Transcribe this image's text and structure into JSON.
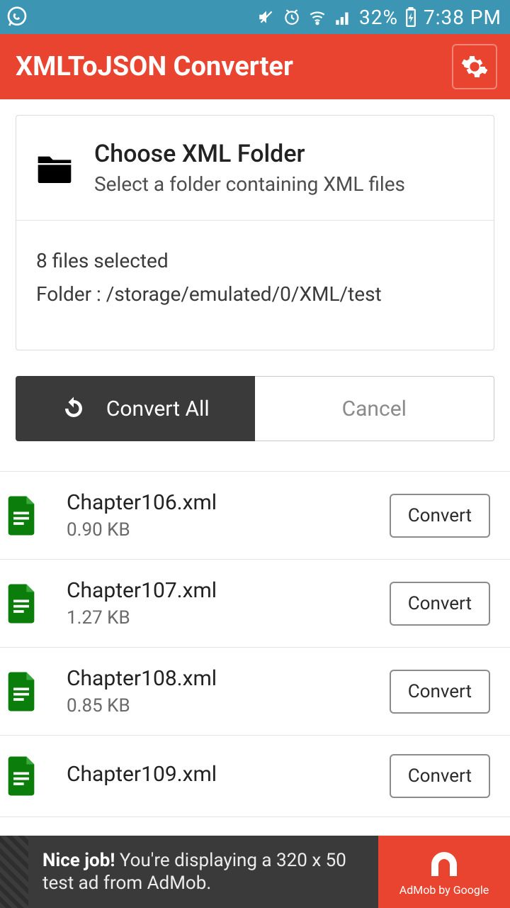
{
  "status": {
    "battery_text": "32%",
    "time": "7:38 PM"
  },
  "app_bar": {
    "title": "XMLToJSON Converter"
  },
  "folder_card": {
    "title": "Choose XML Folder",
    "subtitle": "Select a folder containing XML files",
    "count_line": "8 files selected",
    "path_line": "Folder : /storage/emulated/0/XML/test"
  },
  "buttons": {
    "convert_all": "Convert All",
    "cancel": "Cancel",
    "row_convert": "Convert"
  },
  "files": [
    {
      "name": "Chapter106.xml",
      "size": "0.90 KB"
    },
    {
      "name": "Chapter107.xml",
      "size": "1.27 KB"
    },
    {
      "name": "Chapter108.xml",
      "size": "0.85 KB"
    },
    {
      "name": "Chapter109.xml",
      "size": ""
    }
  ],
  "ad": {
    "bold": "Nice job!",
    "rest": " You're displaying a 320 x 50 test ad from AdMob.",
    "brand": "AdMob by Google"
  }
}
